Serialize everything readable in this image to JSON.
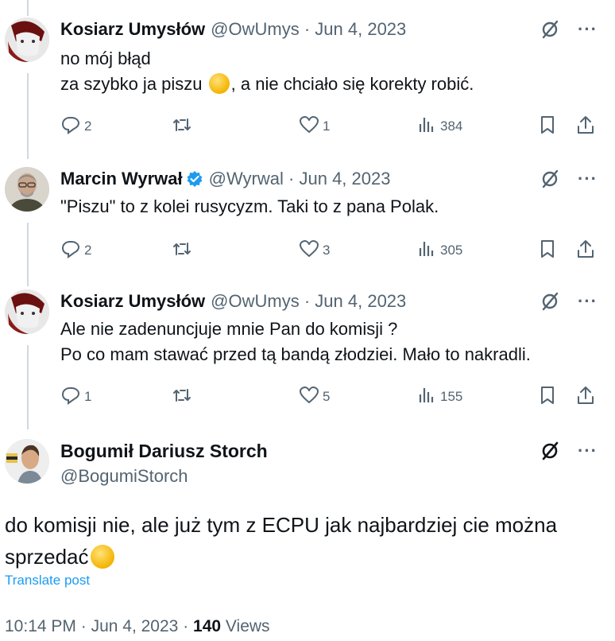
{
  "tweets": [
    {
      "name": "Kosiarz Umysłów",
      "handle": "@OwUmys",
      "date": "Jun 4, 2023",
      "lines": [
        "no mój błąd",
        "za szybko ja piszu",
        ", a nie chciało się korekty robić."
      ],
      "replies": "2",
      "reposts": "",
      "likes": "1",
      "views": "384"
    },
    {
      "name": "Marcin Wyrwał",
      "handle": "@Wyrwal",
      "date": "Jun 4, 2023",
      "lines": [
        "\"Piszu\" to z kolei rusycyzm. Taki to z pana Polak."
      ],
      "replies": "2",
      "reposts": "",
      "likes": "3",
      "views": "305"
    },
    {
      "name": "Kosiarz Umysłów",
      "handle": "@OwUmys",
      "date": "Jun 4, 2023",
      "lines": [
        "Ale nie zadenuncjuje mnie Pan do komisji ?",
        "Po co mam stawać przed tą bandą złodziei. Mało to nakradli."
      ],
      "replies": "1",
      "reposts": "",
      "likes": "5",
      "views": "155"
    }
  ],
  "main_post": {
    "name": "Bogumił Dariusz Storch",
    "handle": "@BogumiStorch",
    "text_line1": "do komisji nie, ale już tym z  ECPU jak najbardziej cie można",
    "text_line2": "sprzedać",
    "translate_label": "Translate post",
    "time": "10:14 PM",
    "date": "Jun 4, 2023",
    "views_count": "140",
    "views_label": "Views"
  },
  "separator": "·",
  "icons": {
    "reply": "reply-icon",
    "repost": "repost-icon",
    "like": "heart-icon",
    "views": "views-chart-icon",
    "bookmark": "bookmark-icon",
    "share": "share-icon",
    "grok": "grok-icon",
    "more": "more-icon",
    "verified": "verified-badge-icon"
  },
  "colors": {
    "text": "#0f1419",
    "secondary": "#536471",
    "link": "#1d9bf0",
    "verified": "#1d9bf0",
    "thread_line": "#cfd9de"
  }
}
